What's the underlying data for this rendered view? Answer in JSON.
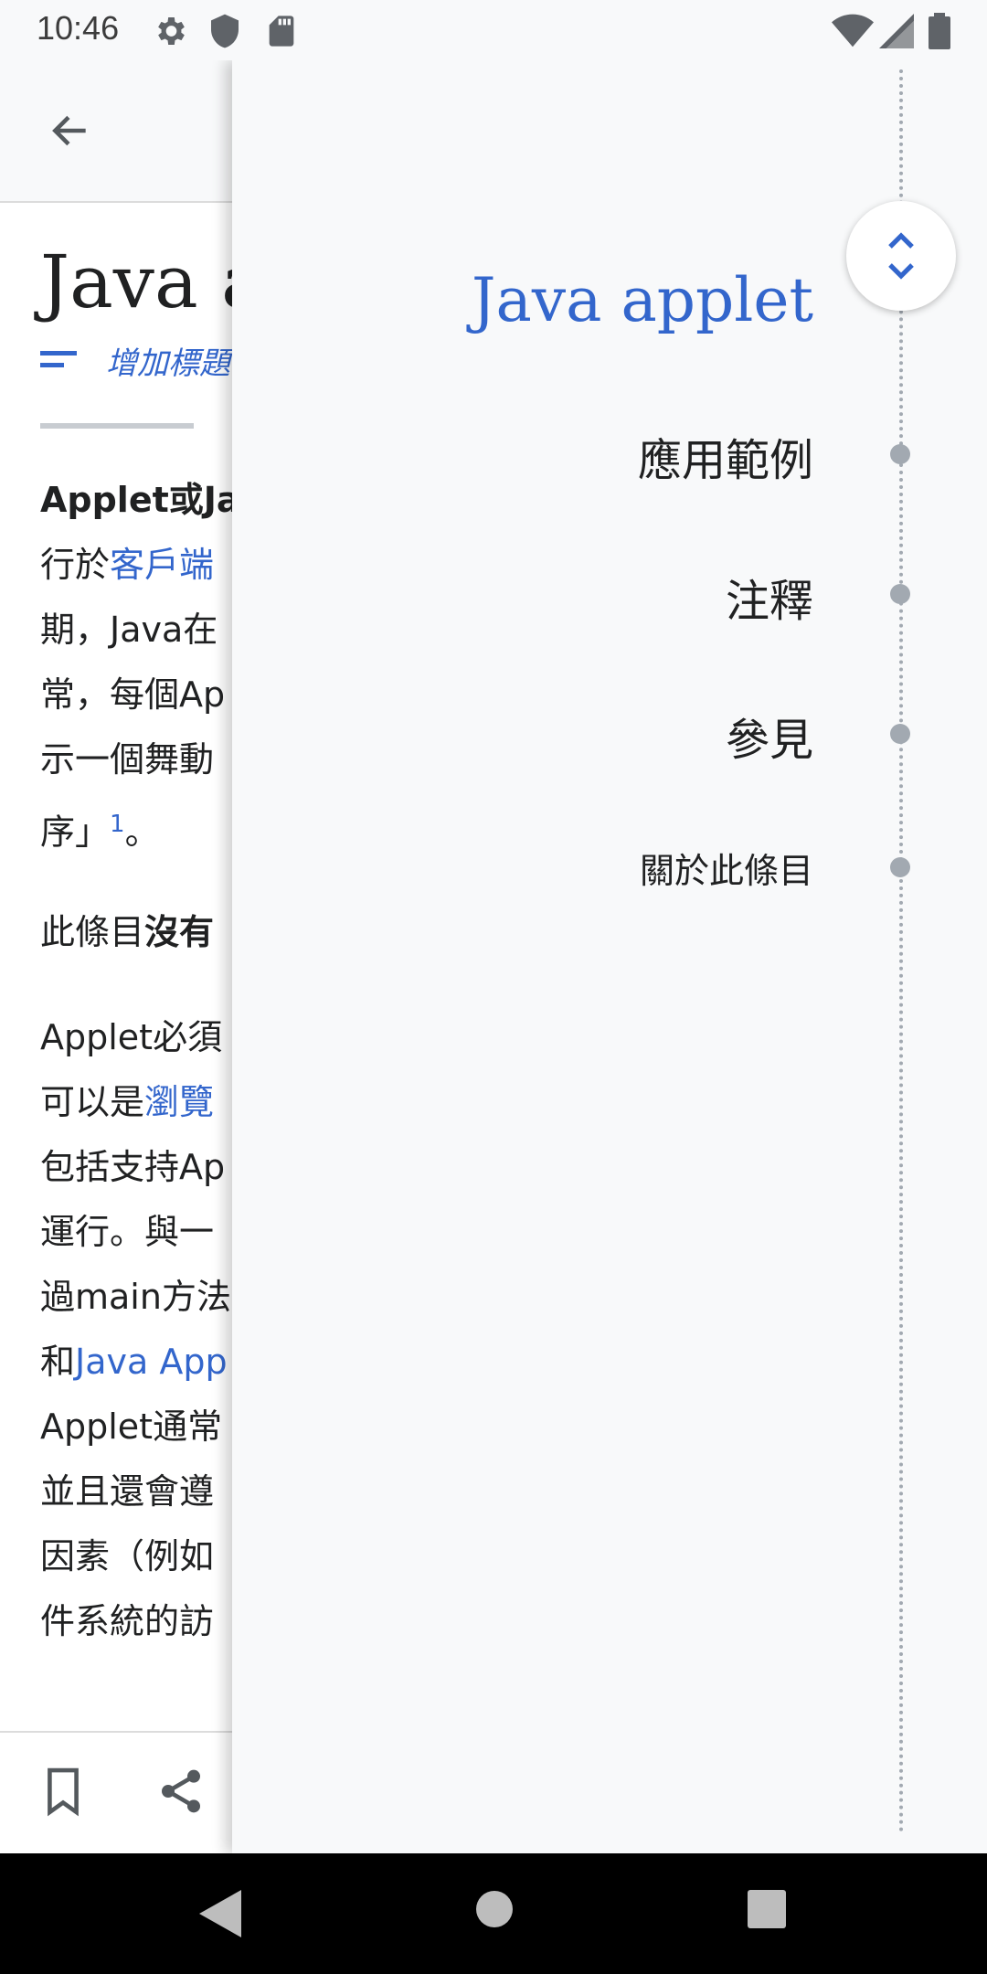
{
  "status_bar": {
    "time": "10:46"
  },
  "article": {
    "title": "Java applet",
    "description_prompt": "增加標題說明",
    "paragraph1": {
      "line1_bold": "Applet或Ja",
      "line2_a": "行於",
      "line2_link": "客戶端",
      "line3": "期，Java在",
      "line4": "常，每個Ap",
      "line5": "示一個舞動",
      "line6_a": "序」",
      "line6_ref": "1",
      "line6_b": "。"
    },
    "paragraph2": {
      "text": "此條目",
      "bold": "沒有"
    },
    "paragraph3": {
      "line1": "Applet必須",
      "line2_a": "可以是",
      "line2_link": "瀏覽",
      "line3": "包括支持Ap",
      "line4": "運行。與一",
      "line5": "過main方法",
      "line6_a": "和",
      "line6_link": "Java App",
      "line7": "Applet通常",
      "line8": "並且還會遵",
      "line9": "因素（例如",
      "line10": "件系統的訪"
    }
  },
  "toc": {
    "title": "Java applet",
    "items": [
      {
        "label": "應用範例"
      },
      {
        "label": "注釋"
      },
      {
        "label": "參見"
      },
      {
        "label": "關於此條目"
      }
    ]
  },
  "colors": {
    "link": "#3366cc",
    "text": "#202122",
    "background": "#f8f9fa",
    "toc_dot": "#a2a9b1"
  }
}
